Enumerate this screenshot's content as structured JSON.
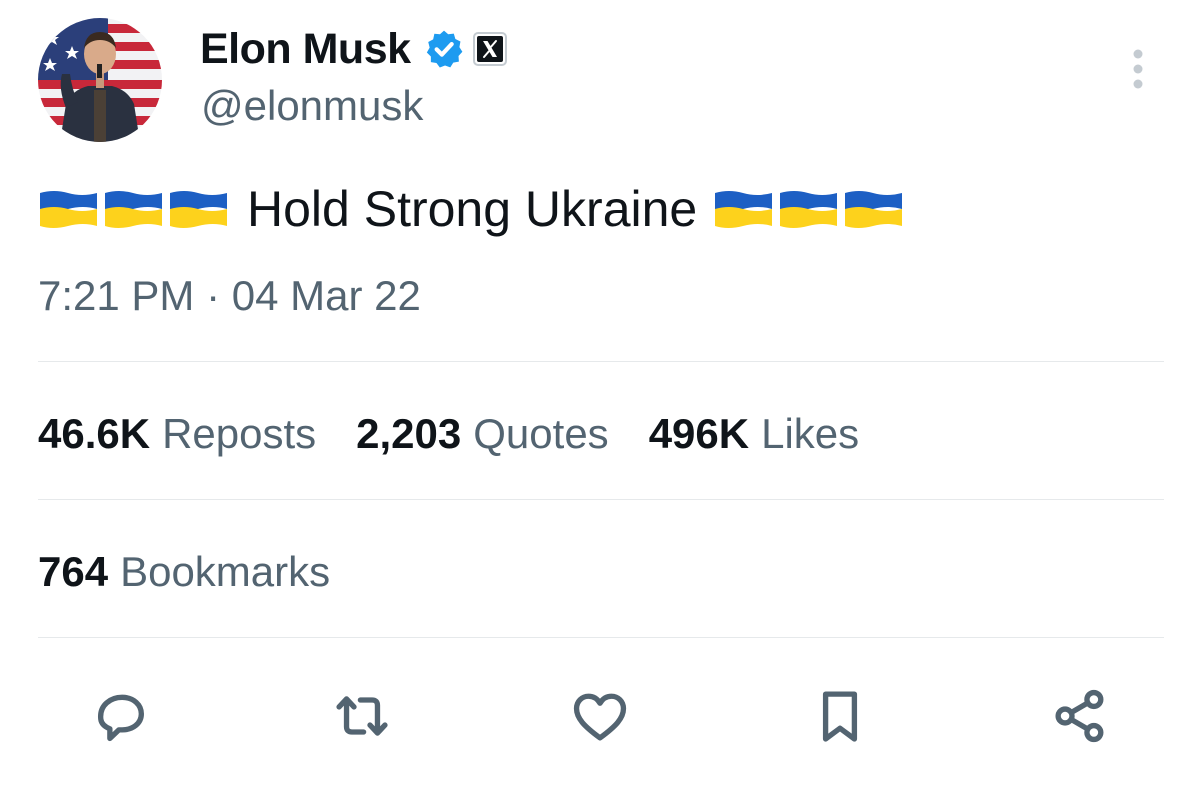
{
  "user": {
    "display_name": "Elon Musk",
    "handle": "@elonmusk",
    "avatar_icon": "profile-photo",
    "verified_icon": "verified-badge-icon",
    "affiliate_icon": "x-logo-icon"
  },
  "tweet": {
    "text": "Hold Strong Ukraine",
    "leading_flags": [
      "🇺🇦",
      "🇺🇦",
      "🇺🇦"
    ],
    "trailing_flags": [
      "🇺🇦",
      "🇺🇦",
      "🇺🇦"
    ],
    "timestamp": "7:21 PM · 04 Mar 22"
  },
  "stats": {
    "reposts": {
      "count": "46.6K",
      "label": "Reposts"
    },
    "quotes": {
      "count": "2,203",
      "label": "Quotes"
    },
    "likes": {
      "count": "496K",
      "label": "Likes"
    },
    "bookmarks": {
      "count": "764",
      "label": "Bookmarks"
    }
  },
  "actions": [
    "reply-icon",
    "repost-icon",
    "like-icon",
    "bookmark-icon",
    "share-icon"
  ],
  "colors": {
    "text_primary": "#0f1419",
    "text_secondary": "#536471",
    "verified_blue": "#1d9bf0",
    "flag_blue": "#0057b7",
    "flag_yellow": "#ffd700"
  }
}
